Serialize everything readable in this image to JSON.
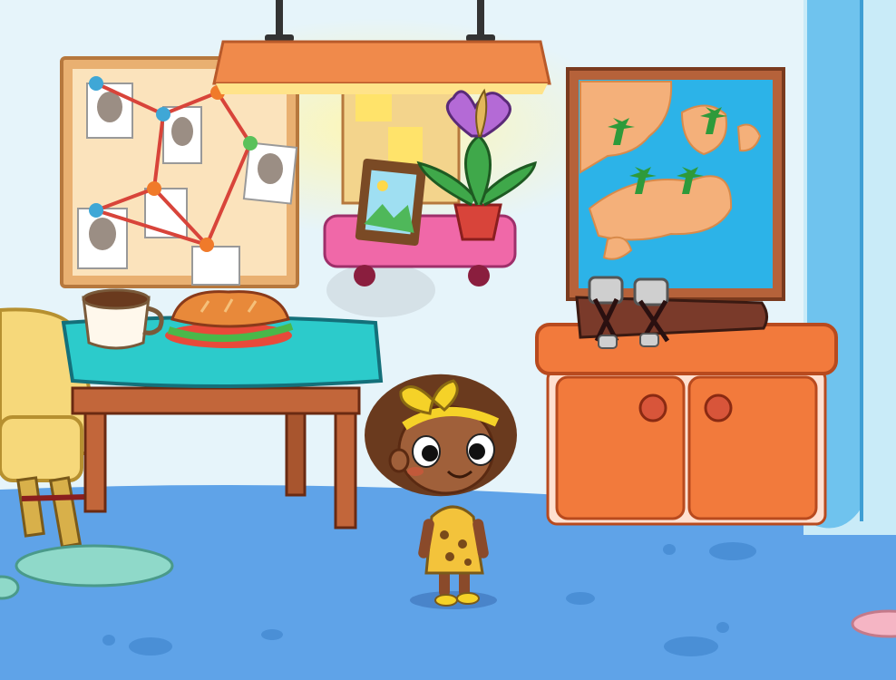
{
  "scene": {
    "wall_color": "#E6F4FA",
    "floor_color": "#5FA3E8",
    "floor_spot_color": "#4A8FD6",
    "pillar_color": "#6FC3EE"
  },
  "objects": {
    "investigation_board": {
      "icon": "cork-board-with-photos-and-red-string",
      "pin_colors": [
        "#3FA7D6",
        "#5AC15A",
        "#F07A2A",
        "#E84A3A"
      ],
      "string_color": "#D8443A"
    },
    "lamp": {
      "icon": "hanging-ceiling-lamp",
      "color": "#F08A4B"
    },
    "notice_board": {
      "icon": "small-cork-board-with-notes"
    },
    "photo_frame": {
      "icon": "framed-landscape-photo"
    },
    "potted_plant": {
      "icon": "purple-flower-in-pot"
    },
    "wall_shelf": {
      "icon": "pink-wall-shelf",
      "color": "#F068A8"
    },
    "island_map": {
      "icon": "framed-island-map",
      "sea_color": "#2CB3E8",
      "land_color": "#F4B07A"
    },
    "coffee_cup": {
      "icon": "coffee-mug"
    },
    "sandwich": {
      "icon": "sub-sandwich"
    },
    "table": {
      "icon": "wooden-table-teal-cloth",
      "cloth_color": "#2CCBCB"
    },
    "armchair": {
      "icon": "yellow-armchair",
      "color": "#F6D87A"
    },
    "stone_tools": {
      "icon": "bundled-stone-axes"
    },
    "cabinet": {
      "icon": "orange-cabinet",
      "color": "#F27A3C"
    },
    "rug": {
      "icon": "round-rug",
      "color": "#8FD9C9"
    },
    "character": {
      "icon": "cavegirl-with-yellow-bow",
      "bow_color": "#F5D228",
      "outfit_color": "#F3C33B"
    }
  }
}
